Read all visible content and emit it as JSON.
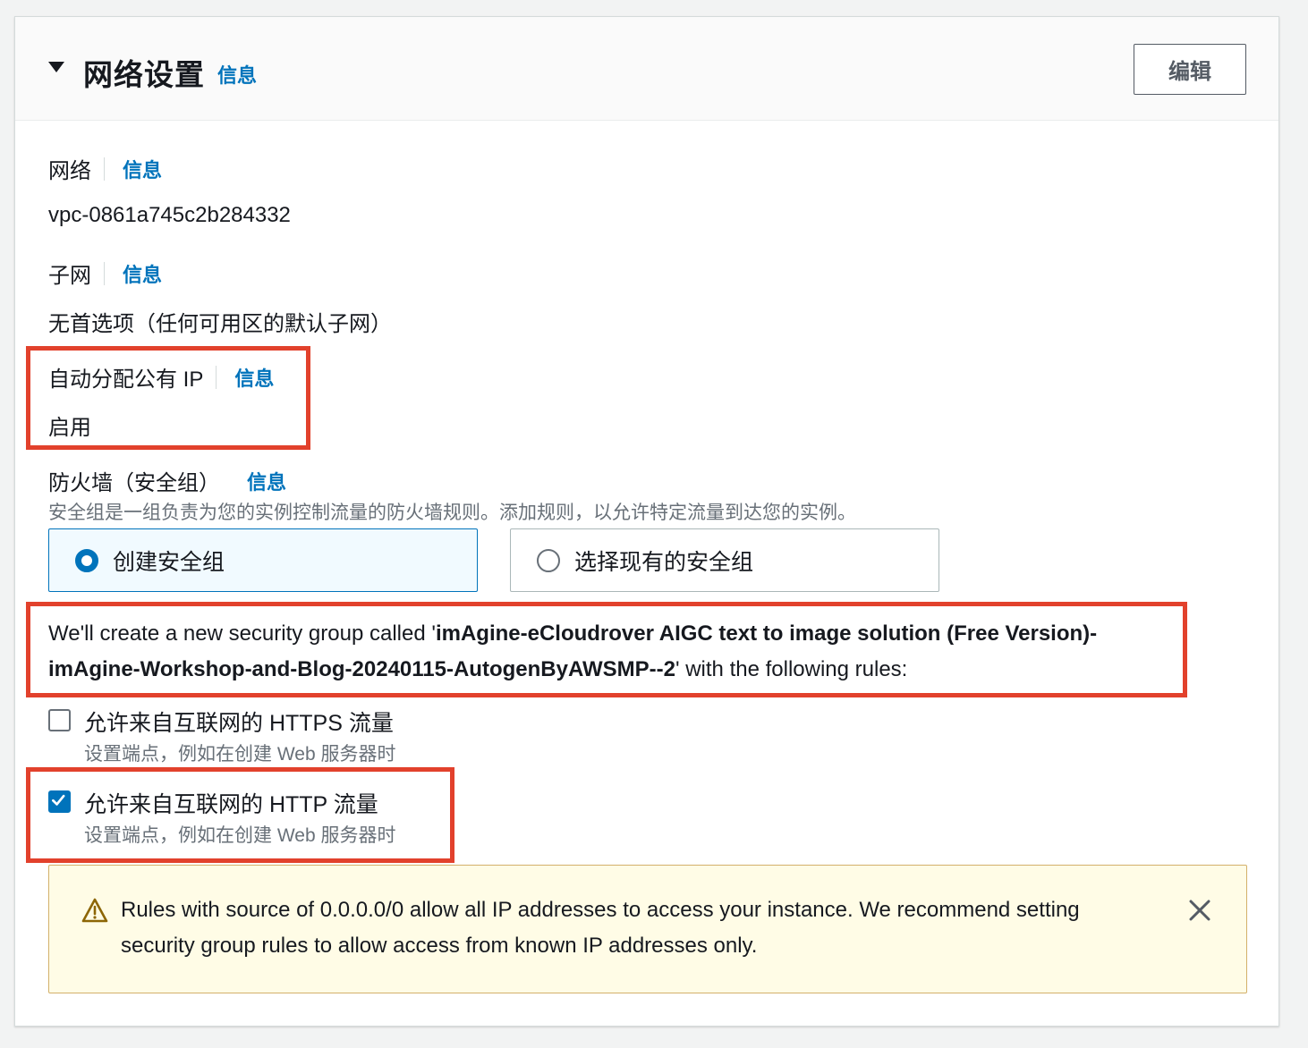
{
  "header": {
    "title": "网络设置",
    "info": "信息",
    "edit_label": "编辑"
  },
  "network": {
    "label": "网络",
    "info": "信息",
    "value": "vpc-0861a745c2b284332"
  },
  "subnet": {
    "label": "子网",
    "info": "信息",
    "value": "无首选项（任何可用区的默认子网）"
  },
  "public_ip": {
    "label": "自动分配公有 IP",
    "info": "信息",
    "value": "启用"
  },
  "firewall": {
    "label": "防火墙（安全组）",
    "info": "信息",
    "description": "安全组是一组负责为您的实例控制流量的防火墙规则。添加规则，以允许特定流量到达您的实例。",
    "options": [
      {
        "label": "创建安全组",
        "selected": true
      },
      {
        "label": "选择现有的安全组",
        "selected": false
      }
    ]
  },
  "security_group": {
    "prefix": "We'll create a new security group called '",
    "name": "imAgine-eCloudrover AIGC text to image solution (Free Version)-imAgine-Workshop-and-Blog-20240115-AutogenByAWSMP--2",
    "suffix": "' with the following rules:"
  },
  "rules": [
    {
      "label": "允许来自互联网的 HTTPS 流量",
      "description": "设置端点，例如在创建 Web 服务器时",
      "checked": false
    },
    {
      "label": "允许来自互联网的 HTTP 流量",
      "description": "设置端点，例如在创建 Web 服务器时",
      "checked": true
    }
  ],
  "warning": {
    "text": "Rules with source of 0.0.0.0/0 allow all IP addresses to access your instance. We recommend setting security group rules to allow access from known IP addresses only."
  },
  "colors": {
    "link": "#0073bb",
    "highlight": "#e2412c",
    "warning_bg": "#fffce6",
    "warning_border": "#d3b06a"
  },
  "icons": [
    "caret-down-icon",
    "warning-icon",
    "close-icon",
    "check-icon"
  ]
}
